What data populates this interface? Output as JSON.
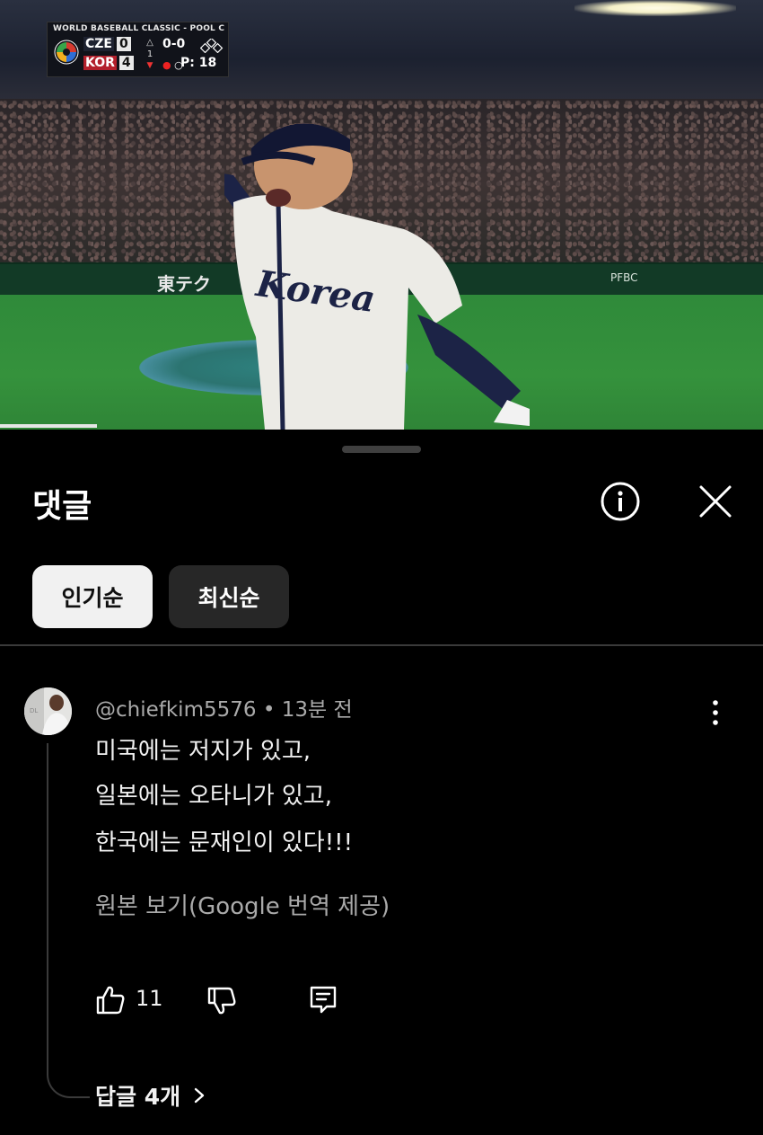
{
  "video": {
    "scoreboard": {
      "title": "WORLD BASEBALL CLASSIC - POOL C",
      "away_team": "CZE",
      "away_score": "0",
      "home_team": "KOR",
      "home_score": "4",
      "inning": "1",
      "count": "0-0",
      "pitch_count": "P: 18"
    },
    "wall_sign": "東テク",
    "wall_sign_right": "PFBC",
    "jersey_text": "Korea",
    "progress": 0.127
  },
  "sheet": {
    "title": "댓글",
    "info_icon": "info-icon",
    "close_icon": "close-icon"
  },
  "sort_chips": [
    {
      "label": "인기순",
      "active": true
    },
    {
      "label": "최신순",
      "active": false
    }
  ],
  "comment": {
    "author": "@chiefkim5576",
    "time": "13분 전",
    "lines": [
      "미국에는 저지가 있고,",
      "일본에는 오타니가 있고,",
      "한국에는 문재인이 있다!!!"
    ],
    "translate_label": "원본 보기(Google 번역 제공)",
    "like_count": "11",
    "replies_label": "답글 4개"
  },
  "colors": {
    "background": "#000000",
    "chip_active_bg": "#f1f1f1",
    "chip_inactive_bg": "#272727",
    "secondary_text": "#aaaaaa"
  }
}
